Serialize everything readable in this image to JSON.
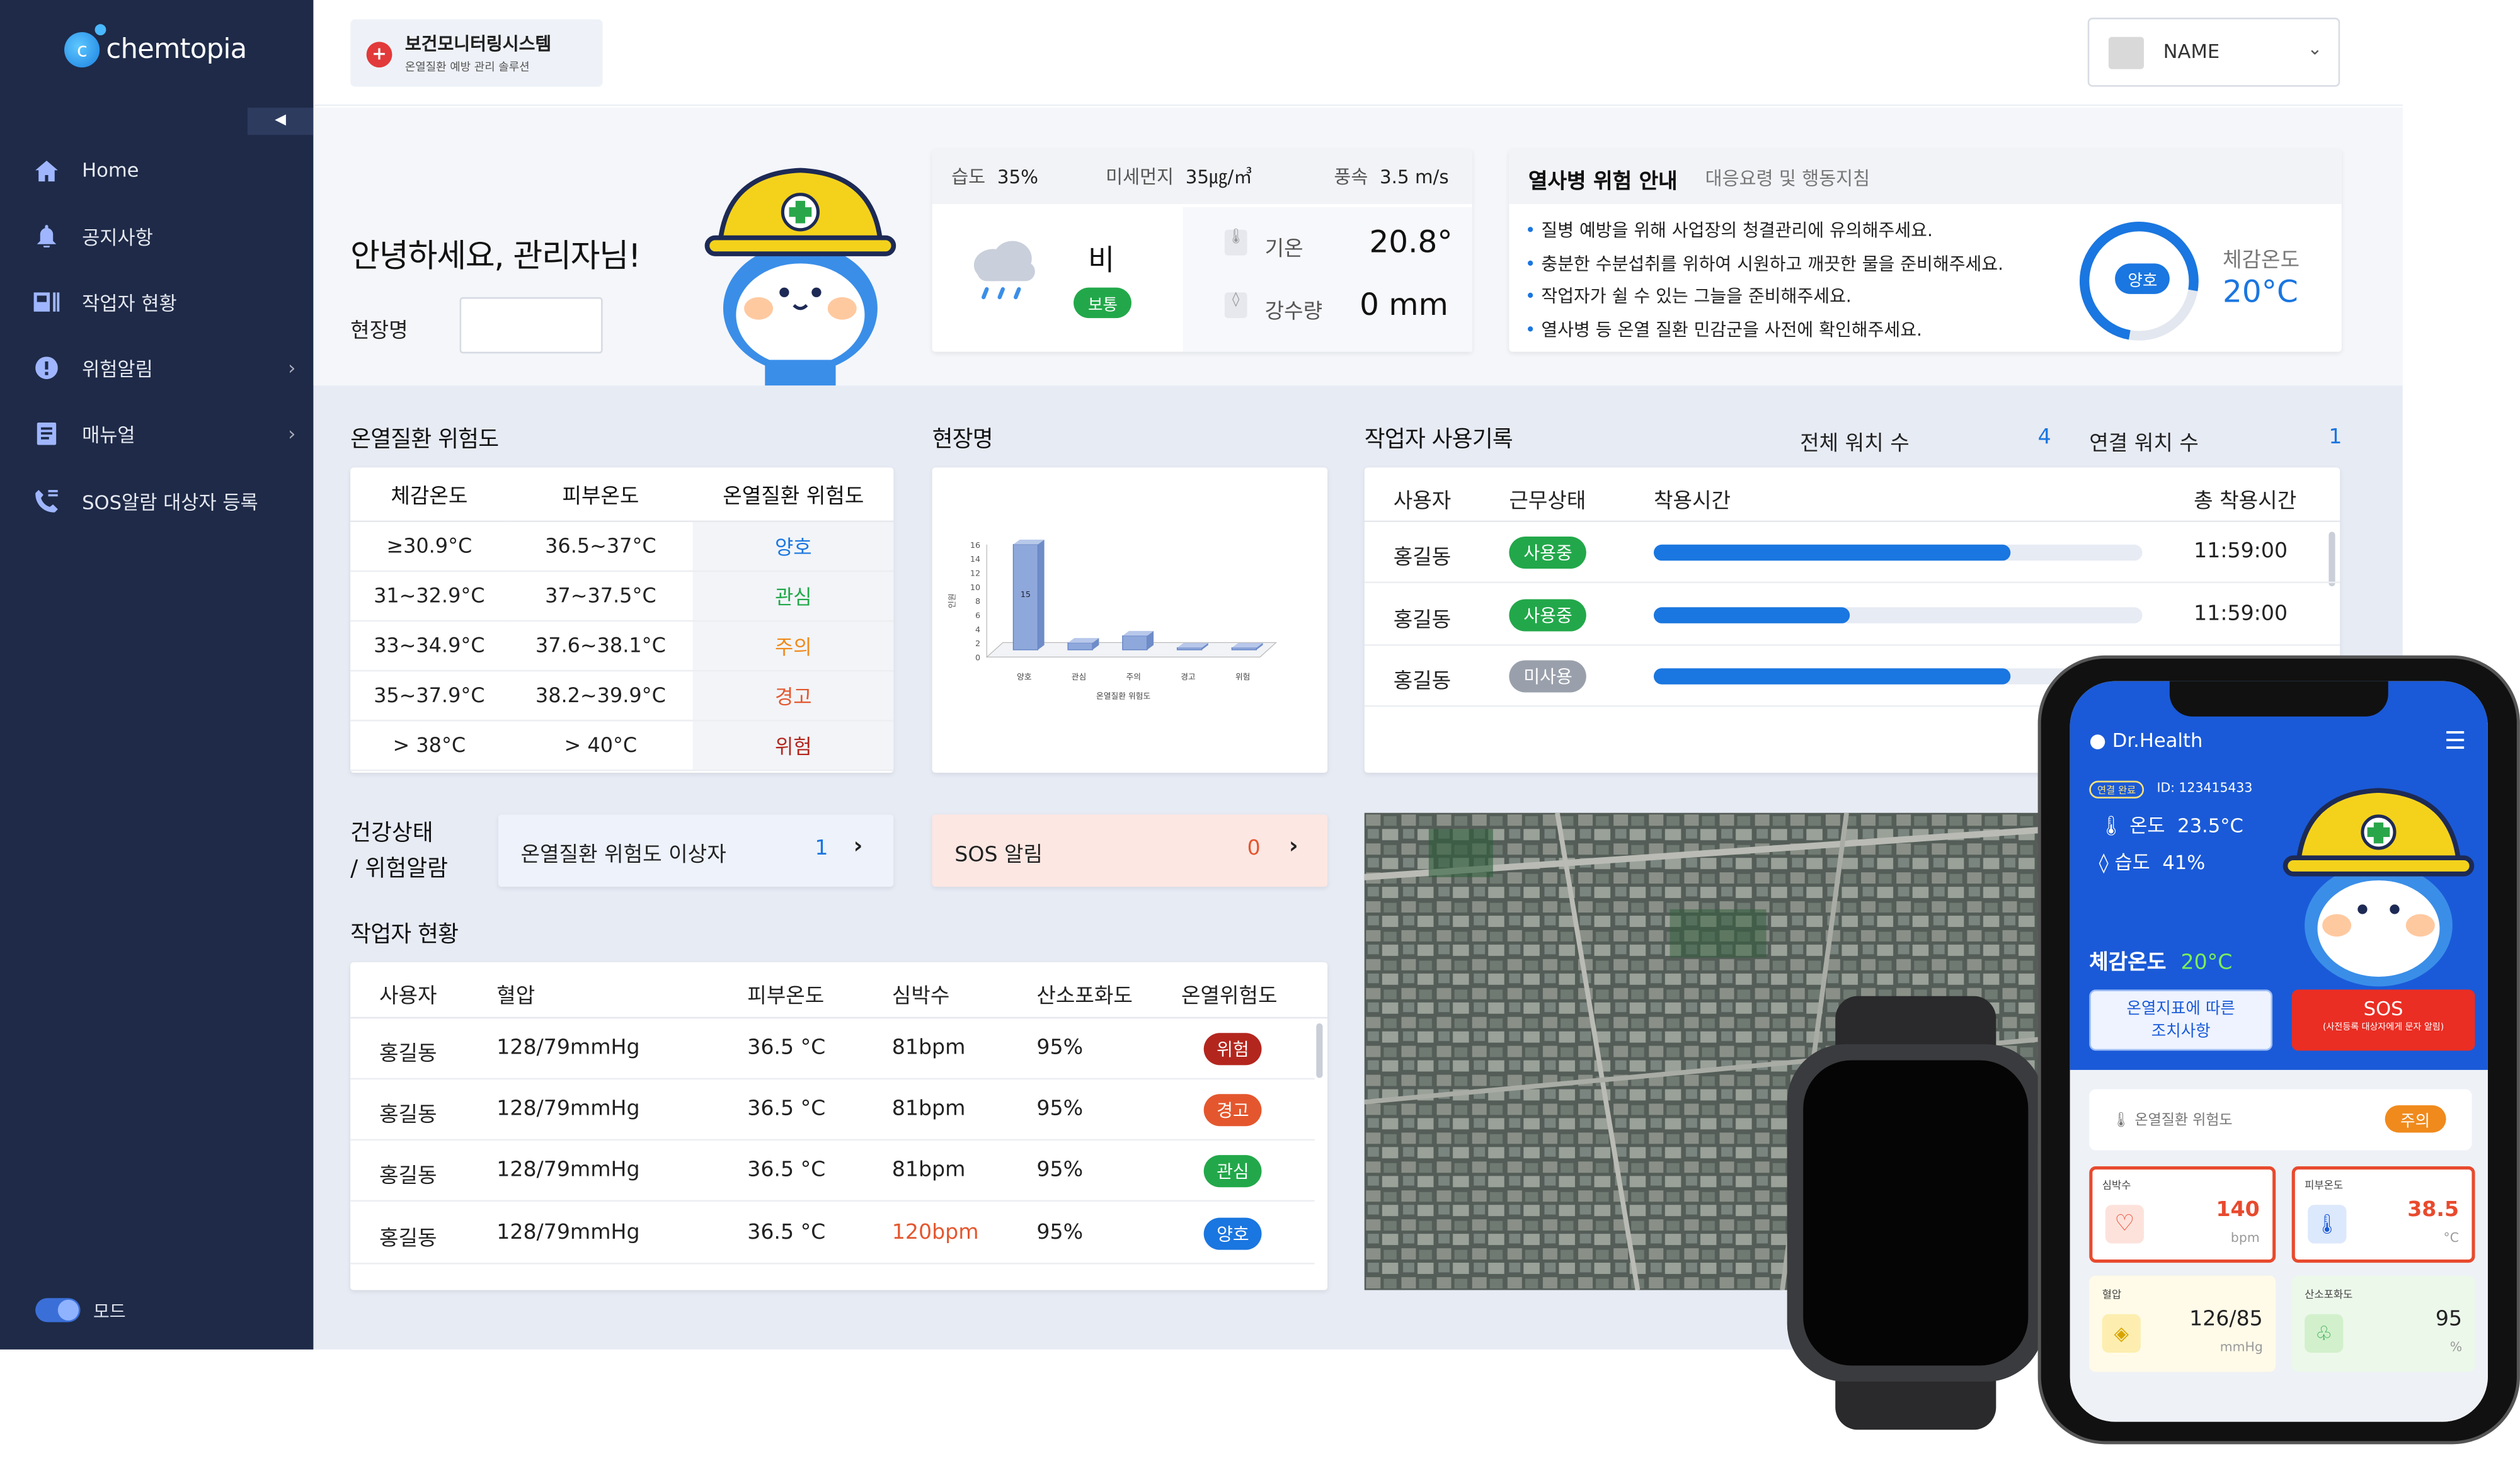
{
  "brand": {
    "name": "chemtopia"
  },
  "sidebar": {
    "items": [
      {
        "label": "Home",
        "icon": "home-icon"
      },
      {
        "label": "공지사항",
        "icon": "bell-icon"
      },
      {
        "label": "작업자 현황",
        "icon": "id-card-icon"
      },
      {
        "label": "위험알림",
        "icon": "alert-icon"
      },
      {
        "label": "매뉴얼",
        "icon": "manual-icon"
      },
      {
        "label": "SOS알람 대상자 등록",
        "icon": "phone-icon"
      }
    ],
    "mode_label": "모드"
  },
  "header": {
    "system_title": "보건모니터링시스템",
    "system_subtitle": "온열질환 예방 관리 솔루션",
    "user_name": "NAME"
  },
  "greeting": {
    "text": "안녕하세요, 관리자님!",
    "site_label": "현장명"
  },
  "weather": {
    "humidity_label": "습도",
    "humidity": "35%",
    "dust_label": "미세먼지",
    "dust": "35㎍/㎥",
    "wind_label": "풍속",
    "wind": "3.5 m/s",
    "condition": "비",
    "grade": "보통",
    "temp_label": "기온",
    "temp": "20.8°",
    "rain_label": "강수량",
    "rain": "0 mm"
  },
  "heat_guide": {
    "title": "열사병 위험 안내",
    "subtitle": "대응요령 및 행동지침",
    "tips": [
      "질병 예방을 위해 사업장의 청결관리에 유의해주세요.",
      "충분한 수분섭취를 위하여 시원하고 깨끗한 물을 준비해주세요.",
      "작업자가 쉴 수 있는 그늘을 준비해주세요.",
      "열사병 등 온열 질환 민감군을 사전에 확인해주세요."
    ],
    "status": "양호",
    "feel_label": "체감온도",
    "feel_value": "20°C"
  },
  "risk_table": {
    "title": "온열질환 위험도",
    "headers": [
      "체감온도",
      "피부온도",
      "온열질환 위험도"
    ],
    "rows": [
      [
        "≥30.9°C",
        "36.5~37°C",
        "양호"
      ],
      [
        "31~32.9°C",
        "37~37.5°C",
        "관심"
      ],
      [
        "33~34.9°C",
        "37.6~38.1°C",
        "주의"
      ],
      [
        "35~37.9°C",
        "38.2~39.9°C",
        "경고"
      ],
      [
        "> 38°C",
        "> 40°C",
        "위험"
      ]
    ]
  },
  "chart_panel": {
    "title": "현장명"
  },
  "chart_data": {
    "type": "bar",
    "categories": [
      "양호",
      "관심",
      "주의",
      "경고",
      "위험"
    ],
    "values": [
      15,
      1,
      2,
      0.3,
      0.3
    ],
    "ylim": [
      0,
      16
    ],
    "yticks": [
      "0",
      "2",
      "4",
      "6",
      "8",
      "10",
      "12",
      "14",
      "16"
    ],
    "ylabel": "인원",
    "xlabel": "온열질환 위험도",
    "data_labels": [
      "15",
      "",
      "",
      "",
      ""
    ]
  },
  "usage": {
    "title": "작업자 사용기록",
    "total_label": "전체 워치 수",
    "total": "4",
    "connected_label": "연결 워치 수",
    "connected": "1",
    "headers": [
      "사용자",
      "근무상태",
      "착용시간",
      "총 착용시간"
    ],
    "rows": [
      {
        "user": "홍길동",
        "status": "사용중",
        "progress": 0.73,
        "total": "11:59:00"
      },
      {
        "user": "홍길동",
        "status": "사용중",
        "progress": 0.4,
        "total": "11:59:00"
      },
      {
        "user": "홍길동",
        "status": "미사용",
        "progress": 0.73,
        "total": ""
      }
    ]
  },
  "alerts": {
    "title_line1": "건강상태",
    "title_line2": "/ 위험알람",
    "heat_label": "온열질환 위험도 이상자",
    "heat_count": "1",
    "sos_label": "SOS 알림",
    "sos_count": "0"
  },
  "workers": {
    "title": "작업자 현황",
    "headers": [
      "사용자",
      "혈압",
      "피부온도",
      "심박수",
      "산소포화도",
      "온열위험도"
    ],
    "rows": [
      [
        "홍길동",
        "128/79mmHg",
        "36.5 °C",
        "81bpm",
        "95%",
        "위험"
      ],
      [
        "홍길동",
        "128/79mmHg",
        "36.5 °C",
        "81bpm",
        "95%",
        "경고"
      ],
      [
        "홍길동",
        "128/79mmHg",
        "36.5 °C",
        "81bpm",
        "95%",
        "관심"
      ],
      [
        "홍길동",
        "128/79mmHg",
        "36.5 °C",
        "120bpm",
        "95%",
        "양호"
      ]
    ]
  },
  "app": {
    "name": "Dr.Health",
    "conn_badge": "연결 완료",
    "id": "ID: 123415433",
    "temp_label": "온도",
    "temp": "23.5°C",
    "hum_label": "습도",
    "hum": "41%",
    "feel_label": "체감온도",
    "feel": "20°C",
    "action_btn_line1": "온열지표에 따른",
    "action_btn_line2": "조치사항",
    "sos_btn": "SOS",
    "sos_sub": "(사전등록 대상자에게 문자 알림)",
    "risk_label": "온열질환 위험도",
    "risk_value": "주의",
    "metrics": [
      {
        "label": "심박수",
        "value": "140",
        "unit": "bpm"
      },
      {
        "label": "피부온도",
        "value": "38.5",
        "unit": "°C"
      },
      {
        "label": "혈압",
        "value": "126/85",
        "unit": "mmHg"
      },
      {
        "label": "산소포화도",
        "value": "95",
        "unit": "%"
      }
    ]
  },
  "colors": {
    "sidebar": "#1e2a47",
    "primary": "#1a76e0",
    "good": "#1a76e0",
    "interest": "#22a84a",
    "caution": "#f08a1c",
    "warning": "#e4572e",
    "danger": "#b3261e"
  }
}
